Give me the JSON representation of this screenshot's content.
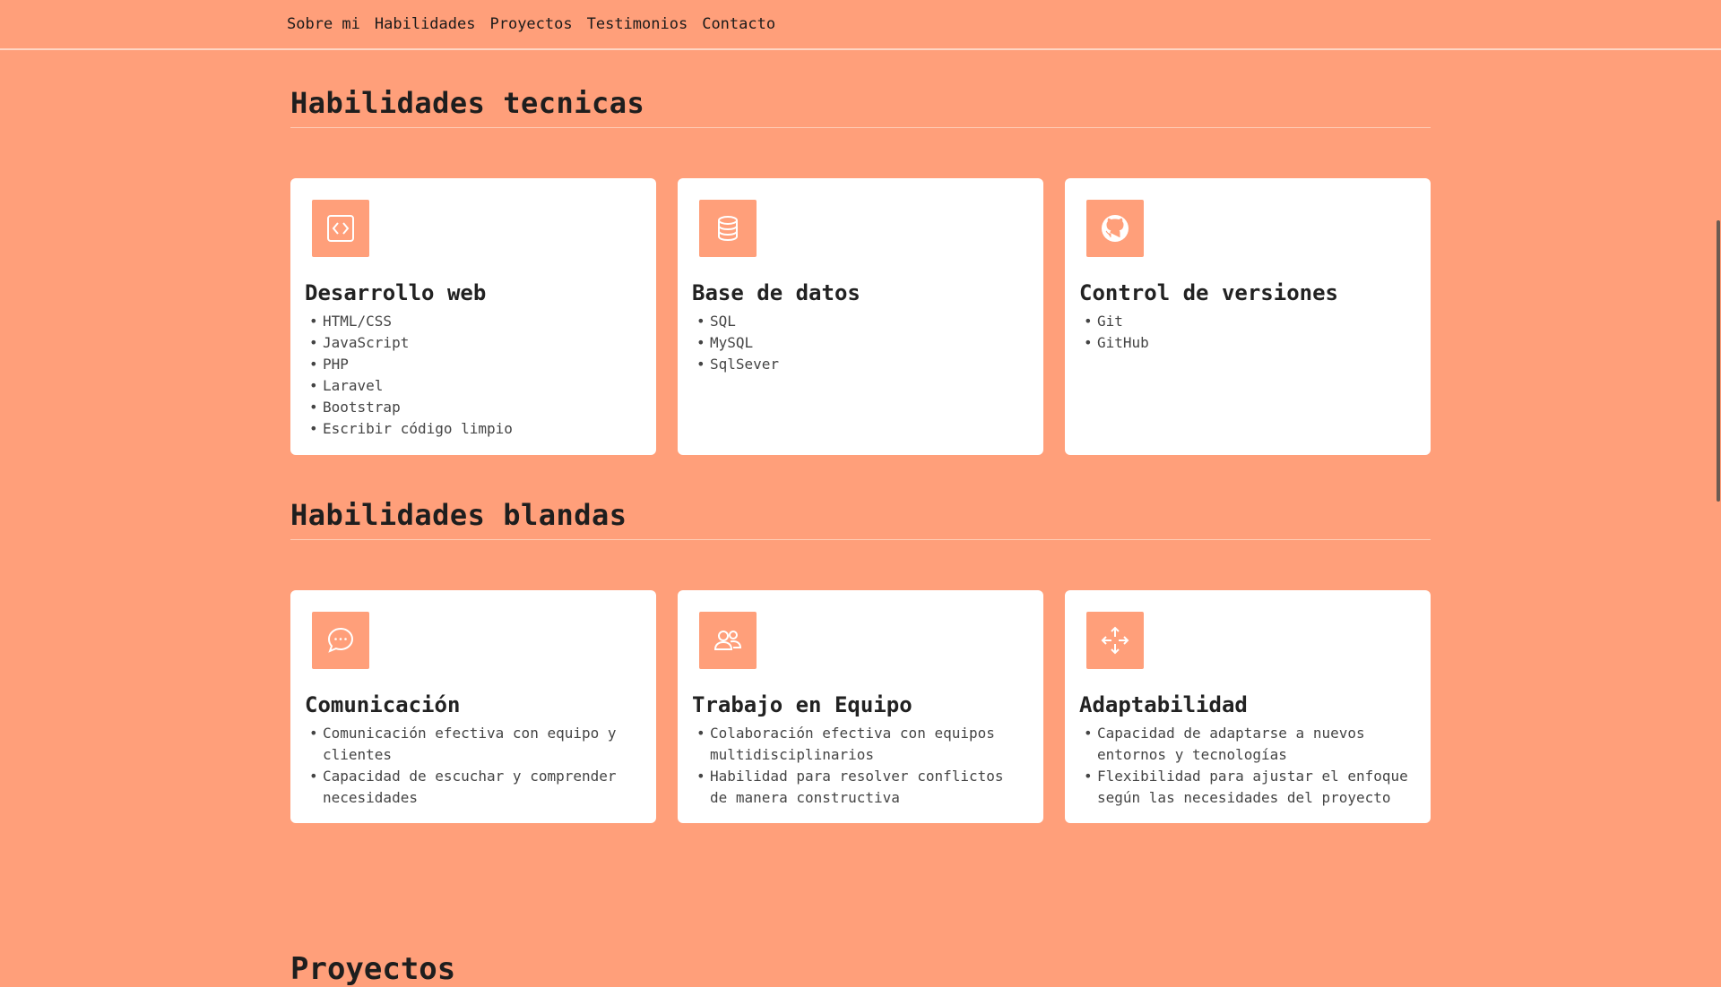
{
  "nav": {
    "items": [
      "Sobre mi",
      "Habilidades",
      "Proyectos",
      "Testimonios",
      "Contacto"
    ]
  },
  "technical": {
    "title": "Habilidades tecnicas",
    "cards": [
      {
        "title": "Desarrollo web",
        "icon": "code-icon",
        "items": [
          "HTML/CSS",
          "JavaScript",
          "PHP",
          "Laravel",
          "Bootstrap",
          "Escribir código limpio"
        ]
      },
      {
        "title": "Base de datos",
        "icon": "database-icon",
        "items": [
          "SQL",
          "MySQL",
          "SqlSever"
        ]
      },
      {
        "title": "Control de versiones",
        "icon": "github-icon",
        "items": [
          "Git",
          "GitHub"
        ]
      }
    ]
  },
  "soft": {
    "title": "Habilidades blandas",
    "cards": [
      {
        "title": "Comunicación",
        "icon": "chat-icon",
        "items": [
          "Comunicación efectiva con equipo y clientes",
          "Capacidad de escuchar y comprender necesidades"
        ]
      },
      {
        "title": "Trabajo en Equipo",
        "icon": "people-icon",
        "items": [
          "Colaboración efectiva con equipos multidisciplinarios",
          "Habilidad para resolver conflictos de manera constructiva"
        ]
      },
      {
        "title": "Adaptabilidad",
        "icon": "arrows-move-icon",
        "items": [
          "Capacidad de adaptarse a nuevos entornos y tecnologías",
          "Flexibilidad para ajustar el enfoque según las necesidades del proyecto"
        ]
      }
    ]
  },
  "next_section": {
    "title": "Proyectos"
  },
  "colors": {
    "background": "#ff9f7a",
    "card": "#ffffff",
    "accent": "#ff9f7a"
  }
}
